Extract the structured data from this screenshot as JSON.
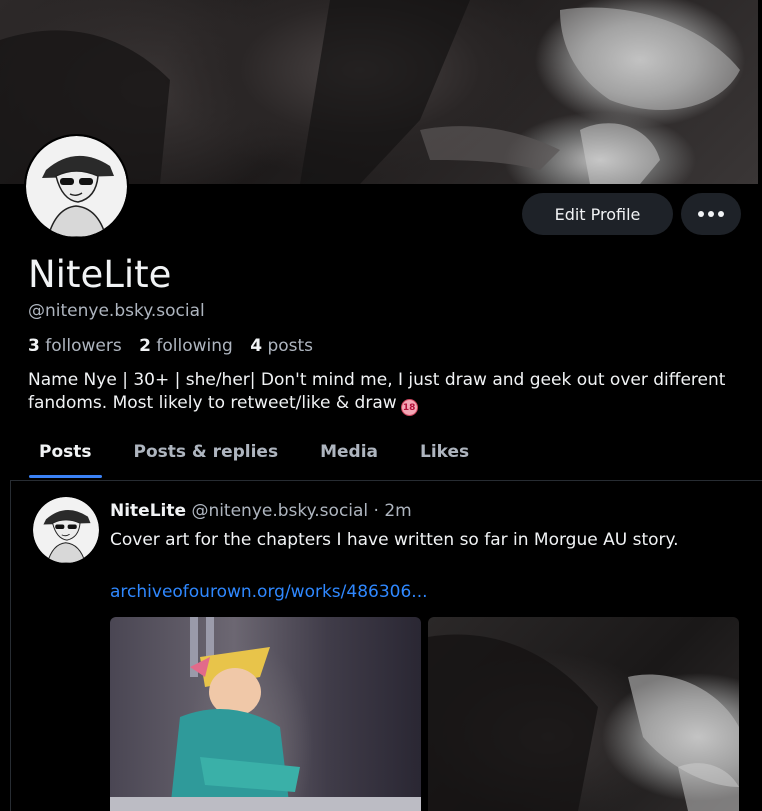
{
  "profile": {
    "display_name": "NiteLite",
    "handle": "@nitenye.bsky.social",
    "followers_count": "3",
    "followers_label": "followers",
    "following_count": "2",
    "following_label": "following",
    "posts_count": "4",
    "posts_label": "posts",
    "bio": "Name Nye | 30+ | she/her| Don't mind me, I just draw and geek out over different fandoms. Most likely to retweet/like & draw",
    "bio_emoji": "18"
  },
  "actions": {
    "edit_label": "Edit Profile",
    "more_icon": "more-horizontal-icon"
  },
  "tabs": [
    {
      "label": "Posts",
      "active": true
    },
    {
      "label": "Posts & replies",
      "active": false
    },
    {
      "label": "Media",
      "active": false
    },
    {
      "label": "Likes",
      "active": false
    }
  ],
  "post": {
    "author_name": "NiteLite",
    "author_handle": "@nitenye.bsky.social",
    "time": " · 2m",
    "text": "Cover art for the chapters I have written so far in Morgue AU story.",
    "link": "archiveofourown.org/works/486306..."
  },
  "colors": {
    "background": "#000000",
    "accent": "#3b82f6",
    "link": "#2f88ff",
    "button_bg": "#1e2228",
    "muted_text": "#aeb5bf"
  }
}
